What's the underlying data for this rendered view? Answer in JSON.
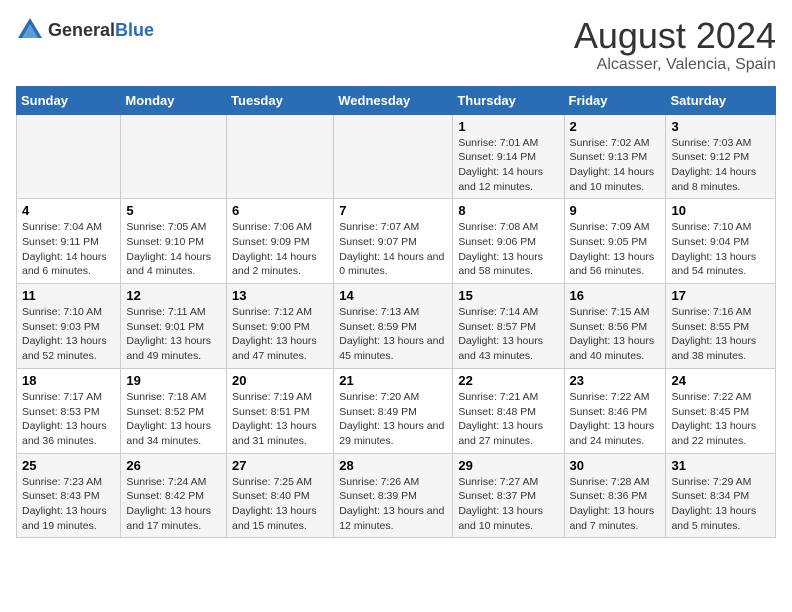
{
  "header": {
    "logo_general": "General",
    "logo_blue": "Blue",
    "main_title": "August 2024",
    "subtitle": "Alcasser, Valencia, Spain"
  },
  "days_of_week": [
    "Sunday",
    "Monday",
    "Tuesday",
    "Wednesday",
    "Thursday",
    "Friday",
    "Saturday"
  ],
  "weeks": [
    [
      {
        "day": "",
        "info": ""
      },
      {
        "day": "",
        "info": ""
      },
      {
        "day": "",
        "info": ""
      },
      {
        "day": "",
        "info": ""
      },
      {
        "day": "1",
        "info": "Sunrise: 7:01 AM\nSunset: 9:14 PM\nDaylight: 14 hours and 12 minutes."
      },
      {
        "day": "2",
        "info": "Sunrise: 7:02 AM\nSunset: 9:13 PM\nDaylight: 14 hours and 10 minutes."
      },
      {
        "day": "3",
        "info": "Sunrise: 7:03 AM\nSunset: 9:12 PM\nDaylight: 14 hours and 8 minutes."
      }
    ],
    [
      {
        "day": "4",
        "info": "Sunrise: 7:04 AM\nSunset: 9:11 PM\nDaylight: 14 hours and 6 minutes."
      },
      {
        "day": "5",
        "info": "Sunrise: 7:05 AM\nSunset: 9:10 PM\nDaylight: 14 hours and 4 minutes."
      },
      {
        "day": "6",
        "info": "Sunrise: 7:06 AM\nSunset: 9:09 PM\nDaylight: 14 hours and 2 minutes."
      },
      {
        "day": "7",
        "info": "Sunrise: 7:07 AM\nSunset: 9:07 PM\nDaylight: 14 hours and 0 minutes."
      },
      {
        "day": "8",
        "info": "Sunrise: 7:08 AM\nSunset: 9:06 PM\nDaylight: 13 hours and 58 minutes."
      },
      {
        "day": "9",
        "info": "Sunrise: 7:09 AM\nSunset: 9:05 PM\nDaylight: 13 hours and 56 minutes."
      },
      {
        "day": "10",
        "info": "Sunrise: 7:10 AM\nSunset: 9:04 PM\nDaylight: 13 hours and 54 minutes."
      }
    ],
    [
      {
        "day": "11",
        "info": "Sunrise: 7:10 AM\nSunset: 9:03 PM\nDaylight: 13 hours and 52 minutes."
      },
      {
        "day": "12",
        "info": "Sunrise: 7:11 AM\nSunset: 9:01 PM\nDaylight: 13 hours and 49 minutes."
      },
      {
        "day": "13",
        "info": "Sunrise: 7:12 AM\nSunset: 9:00 PM\nDaylight: 13 hours and 47 minutes."
      },
      {
        "day": "14",
        "info": "Sunrise: 7:13 AM\nSunset: 8:59 PM\nDaylight: 13 hours and 45 minutes."
      },
      {
        "day": "15",
        "info": "Sunrise: 7:14 AM\nSunset: 8:57 PM\nDaylight: 13 hours and 43 minutes."
      },
      {
        "day": "16",
        "info": "Sunrise: 7:15 AM\nSunset: 8:56 PM\nDaylight: 13 hours and 40 minutes."
      },
      {
        "day": "17",
        "info": "Sunrise: 7:16 AM\nSunset: 8:55 PM\nDaylight: 13 hours and 38 minutes."
      }
    ],
    [
      {
        "day": "18",
        "info": "Sunrise: 7:17 AM\nSunset: 8:53 PM\nDaylight: 13 hours and 36 minutes."
      },
      {
        "day": "19",
        "info": "Sunrise: 7:18 AM\nSunset: 8:52 PM\nDaylight: 13 hours and 34 minutes."
      },
      {
        "day": "20",
        "info": "Sunrise: 7:19 AM\nSunset: 8:51 PM\nDaylight: 13 hours and 31 minutes."
      },
      {
        "day": "21",
        "info": "Sunrise: 7:20 AM\nSunset: 8:49 PM\nDaylight: 13 hours and 29 minutes."
      },
      {
        "day": "22",
        "info": "Sunrise: 7:21 AM\nSunset: 8:48 PM\nDaylight: 13 hours and 27 minutes."
      },
      {
        "day": "23",
        "info": "Sunrise: 7:22 AM\nSunset: 8:46 PM\nDaylight: 13 hours and 24 minutes."
      },
      {
        "day": "24",
        "info": "Sunrise: 7:22 AM\nSunset: 8:45 PM\nDaylight: 13 hours and 22 minutes."
      }
    ],
    [
      {
        "day": "25",
        "info": "Sunrise: 7:23 AM\nSunset: 8:43 PM\nDaylight: 13 hours and 19 minutes."
      },
      {
        "day": "26",
        "info": "Sunrise: 7:24 AM\nSunset: 8:42 PM\nDaylight: 13 hours and 17 minutes."
      },
      {
        "day": "27",
        "info": "Sunrise: 7:25 AM\nSunset: 8:40 PM\nDaylight: 13 hours and 15 minutes."
      },
      {
        "day": "28",
        "info": "Sunrise: 7:26 AM\nSunset: 8:39 PM\nDaylight: 13 hours and 12 minutes."
      },
      {
        "day": "29",
        "info": "Sunrise: 7:27 AM\nSunset: 8:37 PM\nDaylight: 13 hours and 10 minutes."
      },
      {
        "day": "30",
        "info": "Sunrise: 7:28 AM\nSunset: 8:36 PM\nDaylight: 13 hours and 7 minutes."
      },
      {
        "day": "31",
        "info": "Sunrise: 7:29 AM\nSunset: 8:34 PM\nDaylight: 13 hours and 5 minutes."
      }
    ]
  ]
}
